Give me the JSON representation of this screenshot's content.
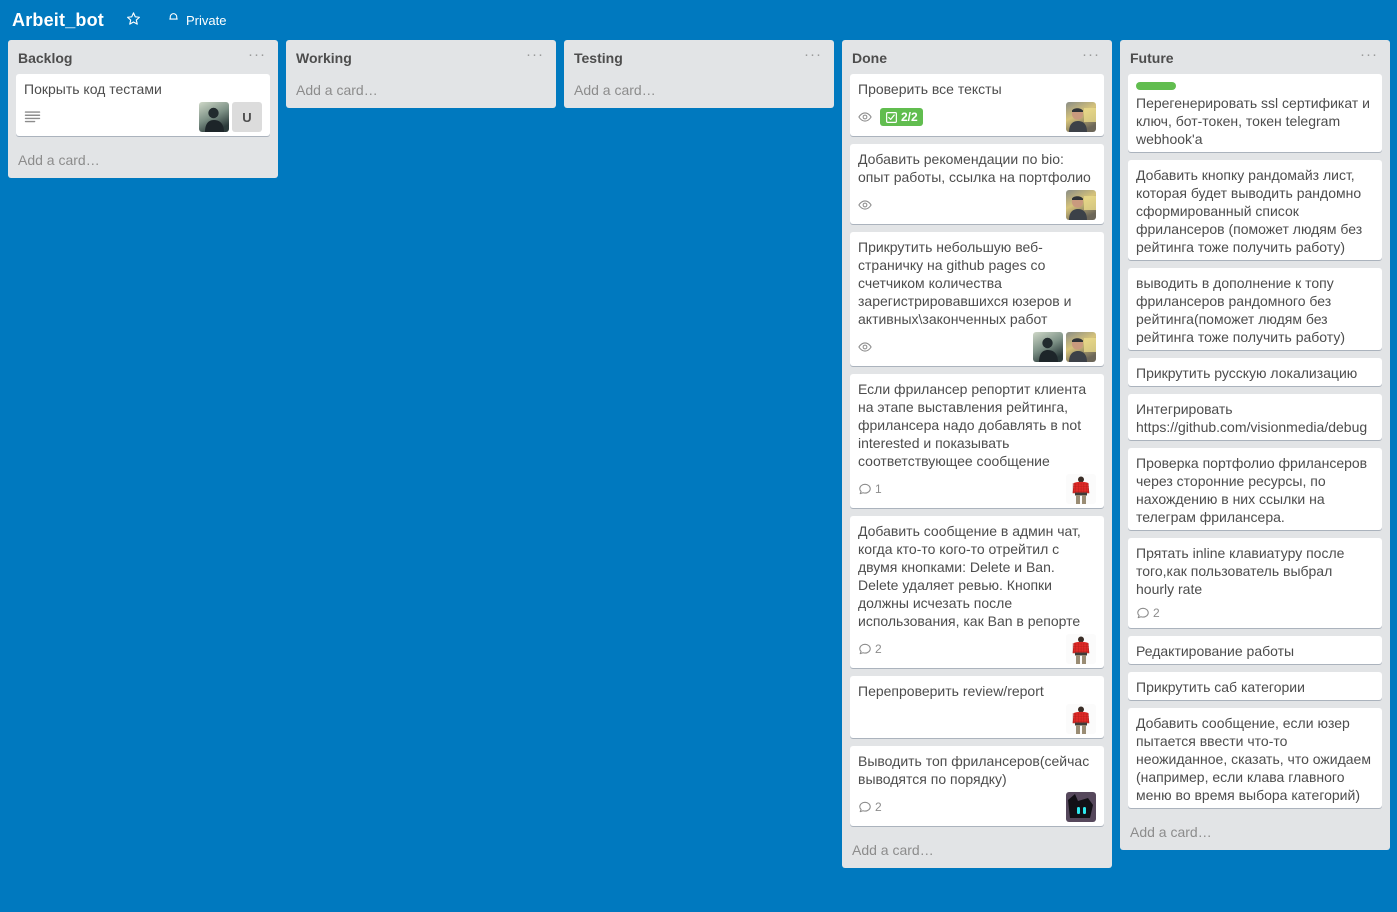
{
  "header": {
    "board_title": "Arbeit_bot",
    "star_icon": "star-icon",
    "lock_icon": "lock-icon",
    "visibility": "Private"
  },
  "colors": {
    "board_background": "#0079bf",
    "list_background": "#e2e4e6",
    "card_background": "#ffffff",
    "label_green": "#61bd4f",
    "badge_green": "#61bd4f",
    "text": "#4d4d4d"
  },
  "list_menu_glyph": "···",
  "add_card_text": "Add a card…",
  "lists": [
    {
      "name": "Backlog",
      "cards": [
        {
          "title": "Покрыть код тестами",
          "description_badge": true,
          "members": [
            {
              "type": "photo",
              "style": "dark-portrait"
            },
            {
              "type": "initials",
              "initials": "U"
            }
          ]
        }
      ]
    },
    {
      "name": "Working",
      "cards": []
    },
    {
      "name": "Testing",
      "cards": []
    },
    {
      "name": "Done",
      "cards": [
        {
          "title": "Проверить все тексты",
          "watch_badge": true,
          "checklist": "2/2",
          "checklist_complete": true,
          "members": [
            {
              "type": "photo",
              "style": "warm-portrait"
            }
          ]
        },
        {
          "title": "Добавить рекомендации по bio: опыт работы, ссылка на портфолио",
          "watch_badge": true,
          "members": [
            {
              "type": "photo",
              "style": "warm-portrait"
            }
          ]
        },
        {
          "title": "Прикрутить небольшую веб-страничку на github pages со счетчиком количества зарегистрировавшихся юзеров и активных\\законченных работ",
          "watch_badge": true,
          "members": [
            {
              "type": "photo",
              "style": "dark-portrait"
            },
            {
              "type": "photo",
              "style": "warm-portrait"
            }
          ]
        },
        {
          "title": "Если фрилансер репортит клиента на этапе выставления рейтинга, фрилансера надо добавлять в not interested и показывать соответствующее сообщение",
          "comments": "1",
          "members": [
            {
              "type": "photo",
              "style": "red-shirt"
            }
          ]
        },
        {
          "title": "Добавить сообщение в админ чат, когда кто-то кого-то отрейтил с двумя кнопками: Delete и Ban. Delete удаляет ревью. Кнопки должны исчезать после использования, как Ban в репорте",
          "comments": "2",
          "members": [
            {
              "type": "photo",
              "style": "red-shirt"
            }
          ]
        },
        {
          "title": "Перепроверить review/report",
          "members": [
            {
              "type": "photo",
              "style": "red-shirt"
            }
          ]
        },
        {
          "title": "Выводить топ фрилансеров(сейчас выводятся по порядку)",
          "comments": "2",
          "members": [
            {
              "type": "photo",
              "style": "cat-dark"
            }
          ]
        }
      ]
    },
    {
      "name": "Future",
      "cards": [
        {
          "title": "Перегенерировать ssl сертификат и ключ, бот-токен, токен telegram webhook'а",
          "label_color": "#61bd4f"
        },
        {
          "title": "Добавить кнопку рандомайз лист, которая будет выводить рандомно сформированный список фрилансеров (поможет людям без рейтинга тоже получить работу)"
        },
        {
          "title": "выводить в дополнение к топу фрилансеров рандомного без рейтинга(поможет людям без рейтинга тоже получить работу)"
        },
        {
          "title": "Прикрутить русскую локализацию"
        },
        {
          "title": "Интегрировать https://github.com/visionmedia/debug"
        },
        {
          "title": "Проверка портфолио фрилансеров через сторонние ресурсы, по нахождению в них ссылки на телеграм фрилансера."
        },
        {
          "title": "Прятать inline клавиатуру после того,как пользователь выбрал hourly rate",
          "comments": "2"
        },
        {
          "title": "Редактирование работы"
        },
        {
          "title": "Прикрутить саб категории"
        },
        {
          "title": "Добавить сообщение, если юзер пытается ввести что-то неожиданное, сказать, что ожидаем (например, если клава главного меню во время выбора категорий)"
        }
      ]
    }
  ]
}
